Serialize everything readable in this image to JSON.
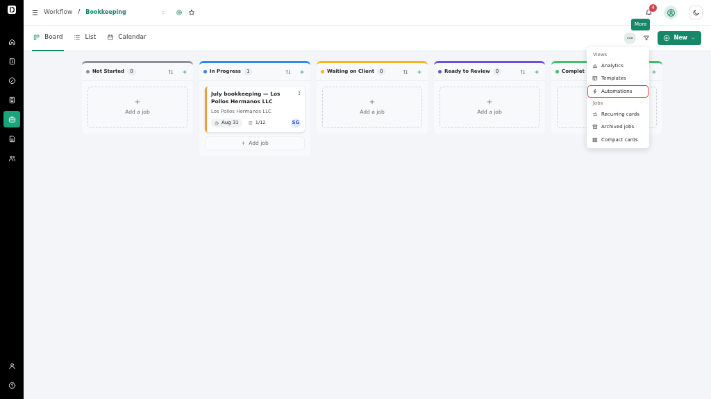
{
  "breadcrumb": {
    "menu_glyph": "☰",
    "parent": "Workflow",
    "separator": "/",
    "current": "Bookkeeping"
  },
  "header": {
    "notification_count": "4"
  },
  "sidebar": {
    "items": [
      {
        "selected": false
      },
      {
        "selected": false
      },
      {
        "selected": false
      },
      {
        "selected": false
      },
      {
        "selected": true
      },
      {
        "selected": false
      },
      {
        "selected": false
      }
    ],
    "bottom_items": [
      {
        "selected": false
      },
      {
        "selected": false
      }
    ]
  },
  "tabs": [
    {
      "label": "Board",
      "selected": true
    },
    {
      "label": "List",
      "selected": false
    },
    {
      "label": "Calendar",
      "selected": false
    }
  ],
  "toolbar": {
    "tooltip": "More",
    "new_button": "New"
  },
  "columns": [
    {
      "name": "Not Started",
      "color": "#8a8f98",
      "count": "0",
      "placeholder": "Add a job"
    },
    {
      "name": "In Progress",
      "color": "#2b8be6",
      "count": "1",
      "cards": [
        {
          "title": "July bookkeeping — Los Pollos Hermanos LLC",
          "client": "Los Pollos Hermanos LLC",
          "due": "Aug 31",
          "progress": "1/12",
          "assignee": "SG"
        }
      ],
      "add_button": "Add job"
    },
    {
      "name": "Waiting on Client",
      "color": "#f2b61f",
      "count": "0",
      "placeholder": "Add a job"
    },
    {
      "name": "Ready to Review",
      "color": "#6b4fe0",
      "count": "0",
      "placeholder": "Add a job"
    },
    {
      "name": "Complet",
      "color": "#3cc26a"
    }
  ],
  "menu": {
    "items": [
      {
        "kind": "header",
        "label": "Views"
      },
      {
        "kind": "item",
        "label": "Analytics",
        "selected": false
      },
      {
        "kind": "item",
        "label": "Templates",
        "selected": false
      },
      {
        "kind": "item",
        "label": "Automations",
        "selected": true
      },
      {
        "kind": "header",
        "label": "Jobs"
      },
      {
        "kind": "item",
        "label": "Recurring cards",
        "selected": false
      },
      {
        "kind": "item",
        "label": "Archived jobs",
        "selected": false
      },
      {
        "kind": "item",
        "label": "Compact cards",
        "selected": false
      }
    ]
  }
}
